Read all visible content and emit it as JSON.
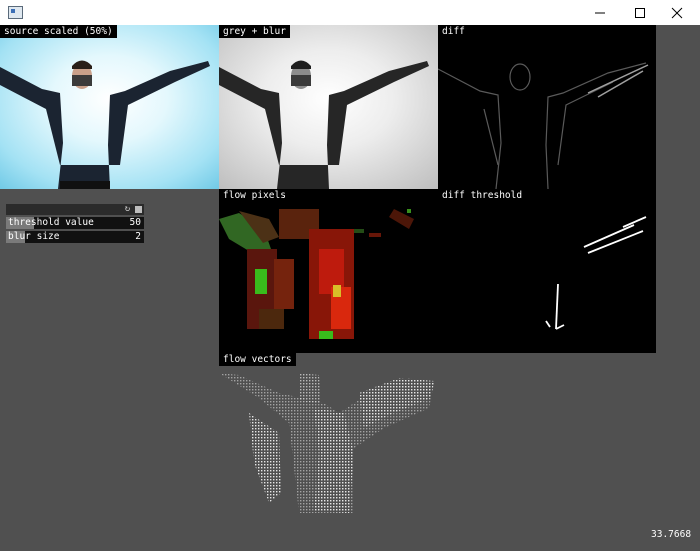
{
  "window": {
    "icons": [
      "app-icon",
      "minimize-icon",
      "maximize-icon",
      "close-icon"
    ]
  },
  "panels": {
    "source": "source scaled (50%)",
    "grey": "grey + blur",
    "diff": "diff",
    "flow_pixels": "flow pixels",
    "diff_threshold": "diff threshold",
    "flow_vectors": "flow vectors"
  },
  "gui": {
    "icons": [
      "reload-icon",
      "save-icon"
    ],
    "sliders": [
      {
        "label": "threshold value",
        "value": "50",
        "fraction": 0.2
      },
      {
        "label": "blur size",
        "value": "2",
        "fraction": 0.14
      }
    ]
  },
  "fps": "33.7668"
}
